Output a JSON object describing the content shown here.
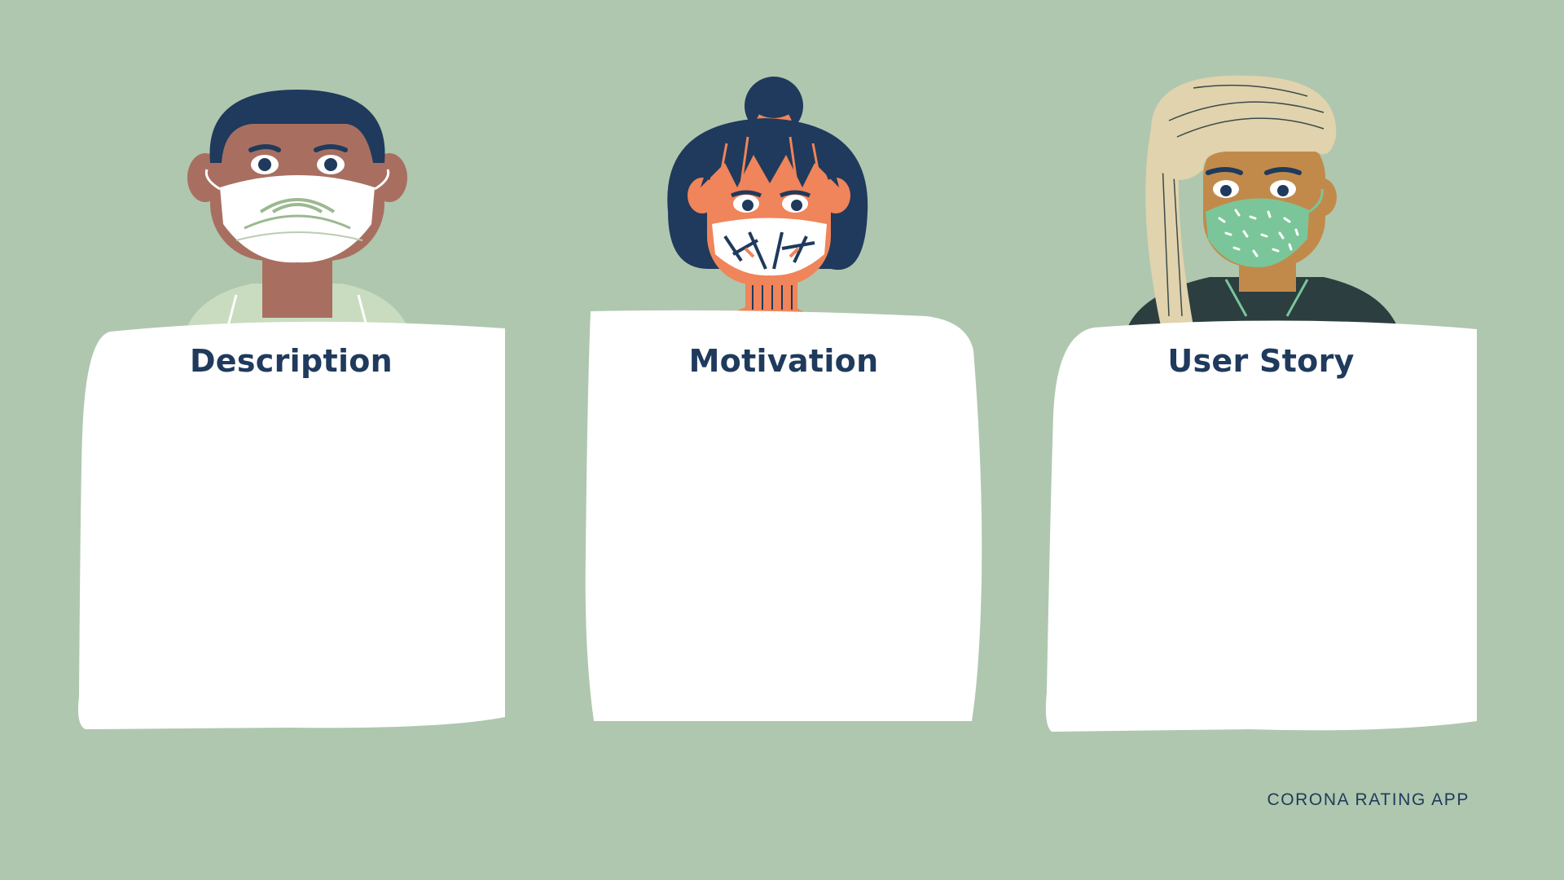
{
  "page": {
    "background_color": "#afc7ae",
    "footer_label": "CORONA RATING APP"
  },
  "cards": [
    {
      "title": "Description",
      "avatar": "man-with-mask-illustration"
    },
    {
      "title": "Motivation",
      "avatar": "woman-with-mask-illustration"
    },
    {
      "title": "User Story",
      "avatar": "turbaned-man-with-mask-illustration"
    }
  ],
  "colors": {
    "title_text": "#1f3a5c",
    "card_fill": "#ffffff"
  }
}
